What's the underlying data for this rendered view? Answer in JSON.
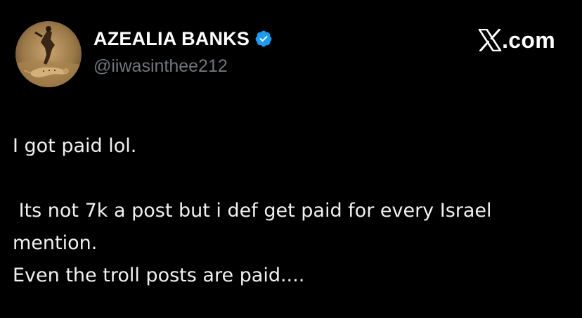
{
  "author": {
    "display_name": "AZEALIA BANKS",
    "handle": "@iiwasinthee212",
    "verified": true,
    "avatar": "avatar-photo-cheetah-runner"
  },
  "brand": {
    "logo": "x-logo-icon",
    "domain": ".com"
  },
  "tweet": {
    "lines": [
      "I got paid lol.",
      "",
      " Its not 7k a post but i def get paid for every Israel",
      "mention.",
      "Even the troll posts are paid...."
    ]
  },
  "colors": {
    "background": "#000000",
    "text": "#f1f1f1",
    "handle": "#71767b",
    "verified": "#1d9bf0"
  }
}
